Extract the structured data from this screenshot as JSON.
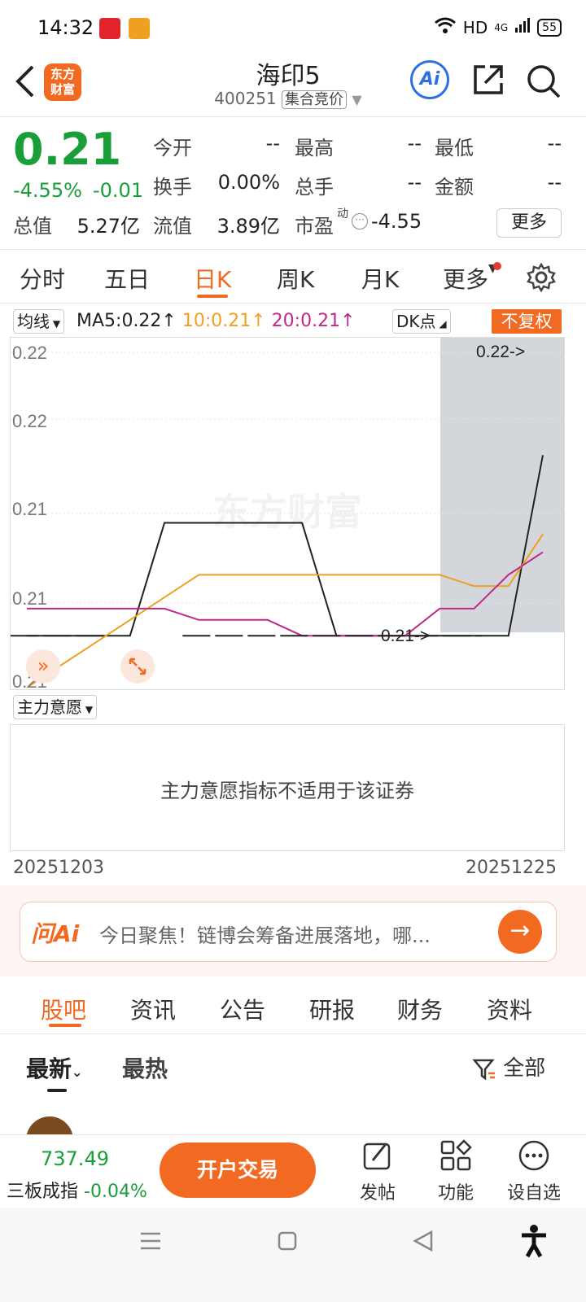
{
  "status": {
    "time": "14:32",
    "network": "HD",
    "signal": "4G",
    "battery": "55"
  },
  "header": {
    "name": "海印5",
    "code": "400251",
    "badge": "集合竞价",
    "logo": "东方\n财富",
    "ai_label": "Ai"
  },
  "quote": {
    "price": "0.21",
    "change_pct": "-4.55%",
    "change": "-0.01",
    "jinkai_l": "今开",
    "jinkai": "--",
    "zuigao_l": "最高",
    "zuigao": "--",
    "zuidi_l": "最低",
    "zuidi": "--",
    "huanshou_l": "换手",
    "huanshou": "0.00%",
    "zongshou_l": "总手",
    "zongshou": "--",
    "jine_l": "金额",
    "jine": "--",
    "zongzhi_l": "总值",
    "zongzhi": "5.27亿",
    "liuzhi_l": "流值",
    "liuzhi": "3.89亿",
    "shiying_l": "市盈",
    "shiying_sup": "动",
    "shiying": "-4.55",
    "more": "更多"
  },
  "tabs": [
    "分时",
    "五日",
    "日K",
    "周K",
    "月K",
    "更多"
  ],
  "chart_header": {
    "ma_select": "均线",
    "ma5": "MA5:0.22↑",
    "ma10": "10:0.21↑",
    "ma20": "20:0.21↑",
    "dk": "DK点",
    "fq": "不复权",
    "colors": {
      "ma5": "#222222",
      "ma10": "#f0a020",
      "ma20": "#c0288a"
    }
  },
  "chart_data": {
    "type": "line",
    "x": [
      "20251203",
      "20251225"
    ],
    "ytick_labels": [
      "0.22",
      "0.22",
      "0.21",
      "0.21",
      "0.21"
    ],
    "annotations": [
      "0.22->",
      "0.21->"
    ],
    "series": [
      {
        "name": "MA5",
        "color": "#222222",
        "values": [
          0.2083,
          0.2083,
          0.2083,
          0.2083,
          0.2133,
          0.2133,
          0.2133,
          0.2133,
          0.2133,
          0.2083,
          0.2083,
          0.2083,
          0.2083,
          0.2083,
          0.2083,
          0.2163
        ]
      },
      {
        "name": "MA10",
        "color": "#f0a020",
        "values": [
          0.206,
          0.207,
          0.208,
          0.209,
          0.21,
          0.211,
          0.211,
          0.211,
          0.211,
          0.211,
          0.211,
          0.211,
          0.211,
          0.2105,
          0.2105,
          0.2128
        ]
      },
      {
        "name": "MA20",
        "color": "#c0288a",
        "values": [
          0.2095,
          0.2095,
          0.2095,
          0.2095,
          0.2095,
          0.209,
          0.209,
          0.209,
          0.2083,
          0.2083,
          0.2083,
          0.2083,
          0.2095,
          0.2095,
          0.211,
          0.212
        ]
      }
    ],
    "grid": true
  },
  "indicator": {
    "select": "主力意愿",
    "message": "主力意愿指标不适用于该证券"
  },
  "dates": {
    "start": "20251203",
    "end": "20251225"
  },
  "ai_bar": {
    "logo": "问Ai",
    "text": "今日聚焦！链博会筹备进展落地，哪..."
  },
  "bottom_tabs": [
    "股吧",
    "资讯",
    "公告",
    "研报",
    "财务",
    "资料"
  ],
  "sort": {
    "newest": "最新",
    "hottest": "最热",
    "filter": "全部"
  },
  "bottom_bar": {
    "index_value": "737.49",
    "index_name": "三板成指",
    "index_change": "-0.04%",
    "trade": "开户交易",
    "post": "发帖",
    "func": "功能",
    "watch": "设自选"
  }
}
